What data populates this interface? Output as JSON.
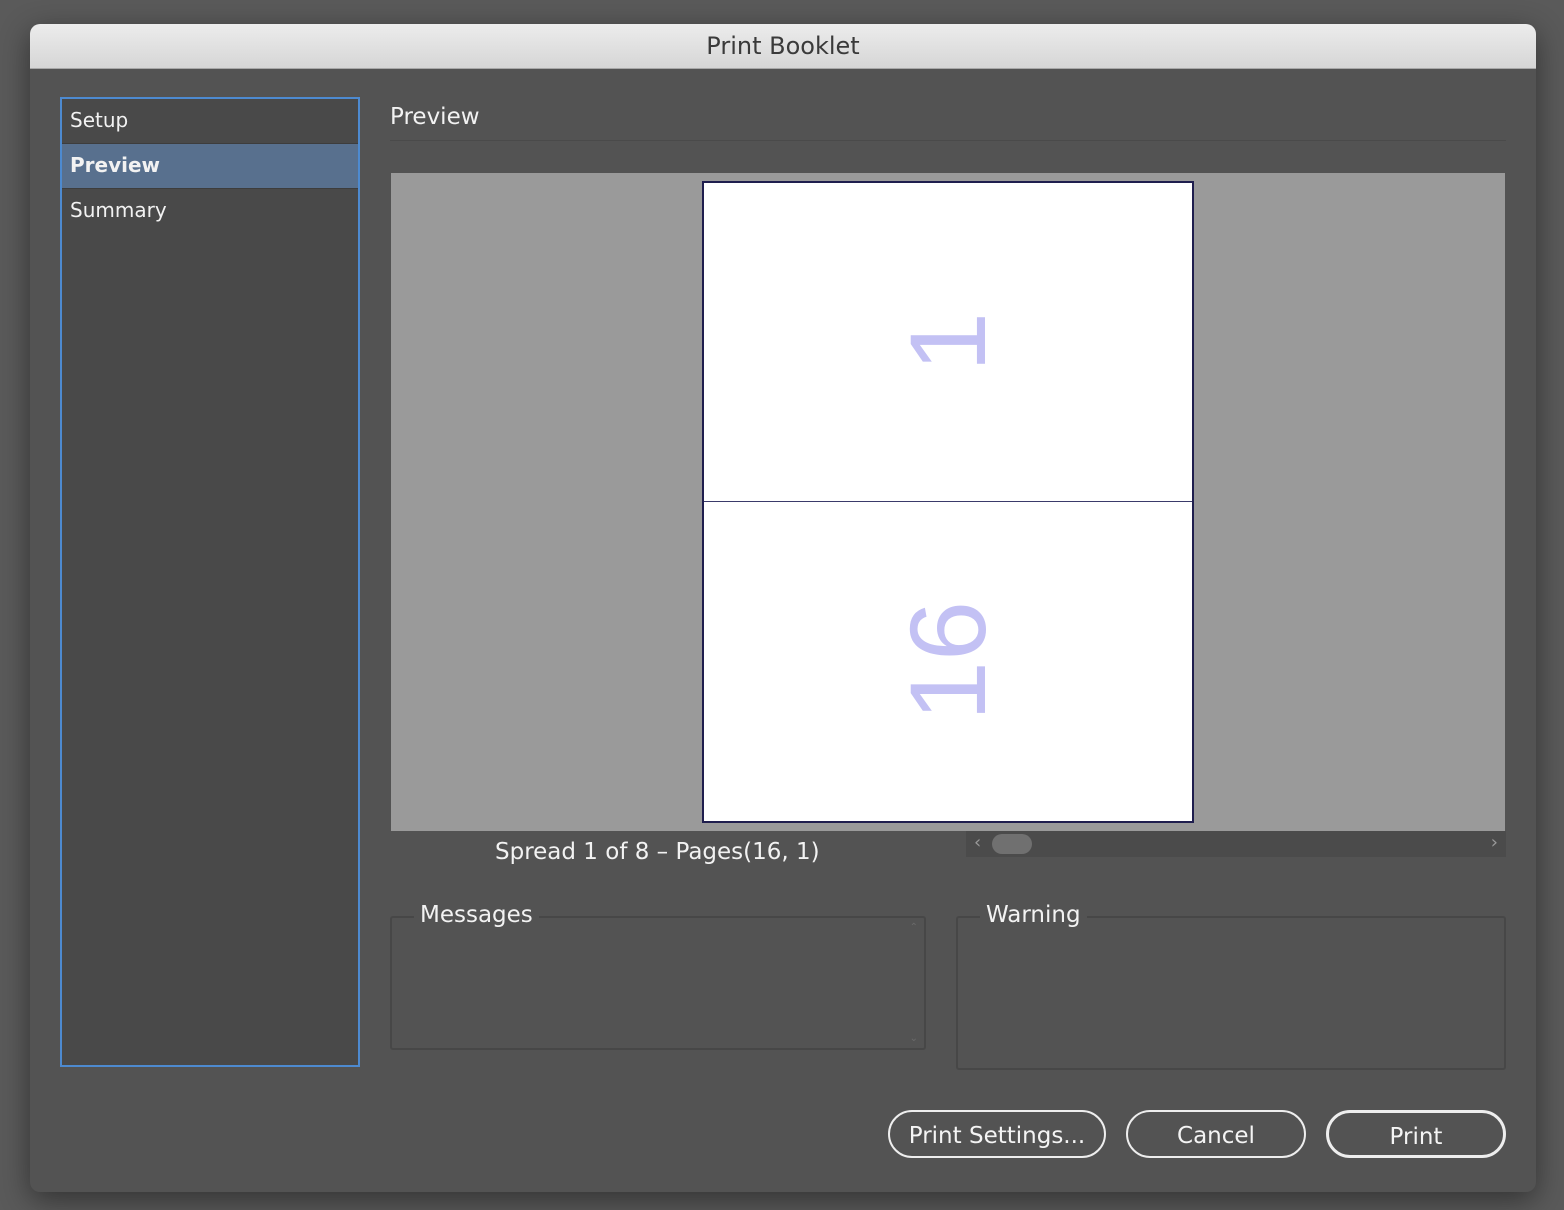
{
  "window": {
    "title": "Print Booklet"
  },
  "sidebar": {
    "items": [
      {
        "label": "Setup",
        "selected": false
      },
      {
        "label": "Preview",
        "selected": true
      },
      {
        "label": "Summary",
        "selected": false
      }
    ]
  },
  "main": {
    "section_title": "Preview",
    "preview": {
      "top_page_number": "1",
      "bottom_page_number": "16"
    },
    "spread_info": "Spread 1 of 8 – Pages(16, 1)",
    "messages": {
      "label": "Messages"
    },
    "warning": {
      "label": "Warning"
    }
  },
  "buttons": {
    "print_settings": "Print Settings...",
    "cancel": "Cancel",
    "print": "Print"
  },
  "colors": {
    "selection": "#58708e",
    "focus_ring": "#4d8ad0",
    "page_number": "#c3c1f4"
  }
}
